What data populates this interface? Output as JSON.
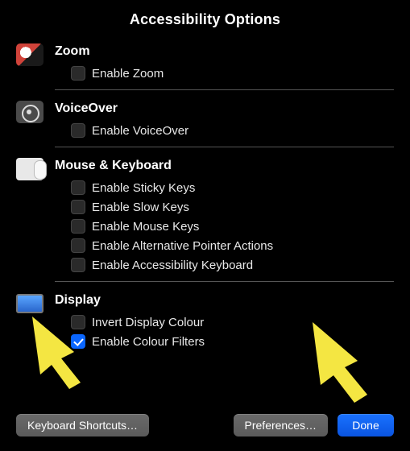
{
  "title": "Accessibility Options",
  "sections": {
    "zoom": {
      "heading": "Zoom",
      "options": [
        {
          "label": "Enable Zoom",
          "checked": false
        }
      ]
    },
    "voiceover": {
      "heading": "VoiceOver",
      "options": [
        {
          "label": "Enable VoiceOver",
          "checked": false
        }
      ]
    },
    "mouseKeyboard": {
      "heading": "Mouse & Keyboard",
      "options": [
        {
          "label": "Enable Sticky Keys",
          "checked": false
        },
        {
          "label": "Enable Slow Keys",
          "checked": false
        },
        {
          "label": "Enable Mouse Keys",
          "checked": false
        },
        {
          "label": "Enable Alternative Pointer Actions",
          "checked": false
        },
        {
          "label": "Enable Accessibility Keyboard",
          "checked": false
        }
      ]
    },
    "display": {
      "heading": "Display",
      "options": [
        {
          "label": "Invert Display Colour",
          "checked": false
        },
        {
          "label": "Enable Colour Filters",
          "checked": true
        }
      ]
    }
  },
  "buttons": {
    "keyboardShortcuts": "Keyboard Shortcuts…",
    "preferences": "Preferences…",
    "done": "Done"
  }
}
